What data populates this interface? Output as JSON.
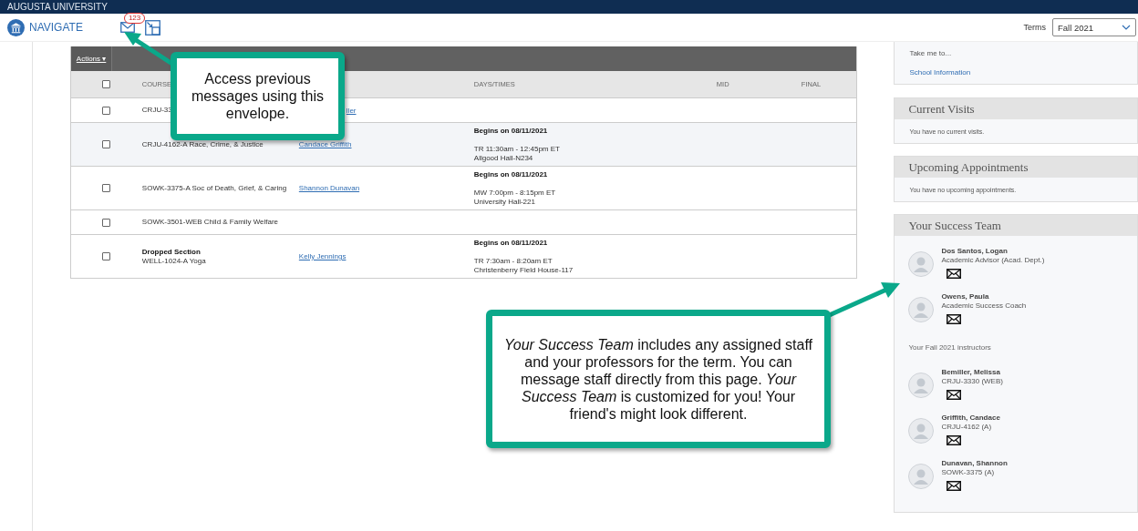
{
  "top_bar": {
    "title": "AUGUSTA UNIVERSITY"
  },
  "nav": {
    "brand": "NAVIGATE",
    "message_count": "123",
    "terms_label": "Terms",
    "terms_value": "Fall 2021"
  },
  "table": {
    "actions_label": "Actions",
    "actions_caret": "▾",
    "header": {
      "checked": false,
      "course": "COURSE",
      "days": "DAYS/TIMES",
      "mid": "MID",
      "final": "FINAL"
    },
    "rows": [
      {
        "checked": false,
        "highlighted": false,
        "course": "CRJU-33",
        "instructor": "ller",
        "instructor_cut": true
      },
      {
        "checked": false,
        "highlighted": true,
        "course": "CRJU-4162-A Race, Crime, & Justice",
        "instructor": "Candace Griffith",
        "begins": "Begins on 08/11/2021",
        "schedule": "TR 11:30am - 12:45pm ET",
        "location": "Allgood Hall-N234"
      },
      {
        "checked": false,
        "highlighted": false,
        "course": "SOWK-3375-A Soc of Death, Grief, & Caring",
        "instructor": "Shannon Dunavan",
        "begins": "Begins on 08/11/2021",
        "schedule": "MW 7:00pm - 8:15pm ET",
        "location": "University Hall-221"
      },
      {
        "checked": false,
        "highlighted": false,
        "course": "SOWK-3501-WEB Child & Family Welfare"
      },
      {
        "checked": false,
        "highlighted": false,
        "status": "Dropped Section",
        "course": "WELL-1024-A Yoga",
        "instructor": "Kelly Jennings",
        "begins": "Begins on 08/11/2021",
        "schedule": "TR 7:30am - 8:20am ET",
        "location": "Christenberry Field House-117"
      }
    ]
  },
  "quick_links": {
    "prompt": "Take me to...",
    "link": "School Information"
  },
  "current_visits": {
    "title": "Current Visits",
    "message": "You have no current visits."
  },
  "upcoming_appointments": {
    "title": "Upcoming Appointments",
    "message": "You have no upcoming appointments."
  },
  "success_team": {
    "title": "Your Success Team",
    "staff": [
      {
        "name": "Dos Santos, Logan",
        "role": "Academic Advisor (Acad. Dept.)"
      },
      {
        "name": "Owens, Paula",
        "role": "Academic Success Coach"
      }
    ],
    "instructors_heading": "Your Fall 2021 instructors",
    "instructors": [
      {
        "name": "Bemiller, Melissa",
        "role": "CRJU-3330 (WEB)"
      },
      {
        "name": "Griffith, Candace",
        "role": "CRJU-4162 (A)"
      },
      {
        "name": "Dunavan, Shannon",
        "role": "SOWK-3375 (A)"
      }
    ]
  },
  "callouts": [
    {
      "text": "Access previous messages using this envelope."
    },
    {
      "text": "*Your Success Team* includes any assigned staff and your professors for the term. You can message staff directly from this page. *Your Success Team* is customized for you! Your friend's might look different."
    }
  ]
}
